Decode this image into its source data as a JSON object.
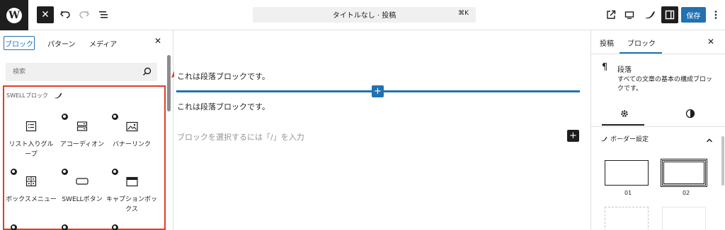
{
  "header": {
    "logo": "W",
    "doc_title": "タイトルなし · 投稿",
    "shortcut": "⌘K",
    "save_label": "保存",
    "accent": "#2271b1"
  },
  "inserter": {
    "tabs": [
      "ブロック",
      "パターン",
      "メディア"
    ],
    "search_placeholder": "検索",
    "category_title": "SWELLブロック",
    "blocks": [
      {
        "label": "リスト入りグループ",
        "icon": "list-icon"
      },
      {
        "label": "アコーディオン",
        "icon": "accordion-icon"
      },
      {
        "label": "バナーリンク",
        "icon": "image-icon"
      },
      {
        "label": "ボックスメニュー",
        "icon": "grid-icon"
      },
      {
        "label": "SWELLボタン",
        "icon": "button-icon"
      },
      {
        "label": "キャプションボックス",
        "icon": "caption-box-icon"
      }
    ],
    "highlight_color": "#e13b2a"
  },
  "canvas": {
    "paragraph_1": "これは段落ブロックです。",
    "paragraph_2": "これは段落ブロックです。",
    "placeholder": "ブロックを選択するには「/」を入力"
  },
  "sidebar": {
    "tabs": [
      "投稿",
      "ブロック"
    ],
    "block_name": "段落",
    "block_description": "すべての文章の基本の構成ブロックです。",
    "section_title": "ボーダー設定",
    "border_styles": [
      "01",
      "02"
    ]
  }
}
